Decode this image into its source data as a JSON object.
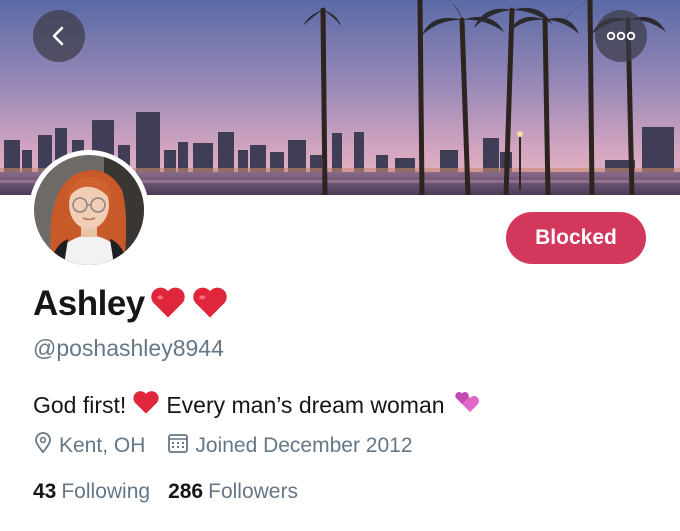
{
  "header": {
    "back_icon": "chevron-left-icon",
    "more_icon": "more-icon"
  },
  "profile": {
    "display_name": "Ashley",
    "name_emoji": "red-heart ×2",
    "handle": "@poshashley8944",
    "action_label": "Blocked",
    "action_color": "#d2375c",
    "bio_part1": "God first!",
    "bio_part2": "Every man’s dream woman",
    "location": "Kent, OH",
    "joined": "Joined December 2012",
    "following_count": "43",
    "following_label": "Following",
    "followers_count": "286",
    "followers_label": "Followers"
  },
  "colors": {
    "text_primary": "#14171a",
    "text_secondary": "#657786",
    "heart": "#e0263a",
    "sparkle_heart": "#e066c8"
  }
}
